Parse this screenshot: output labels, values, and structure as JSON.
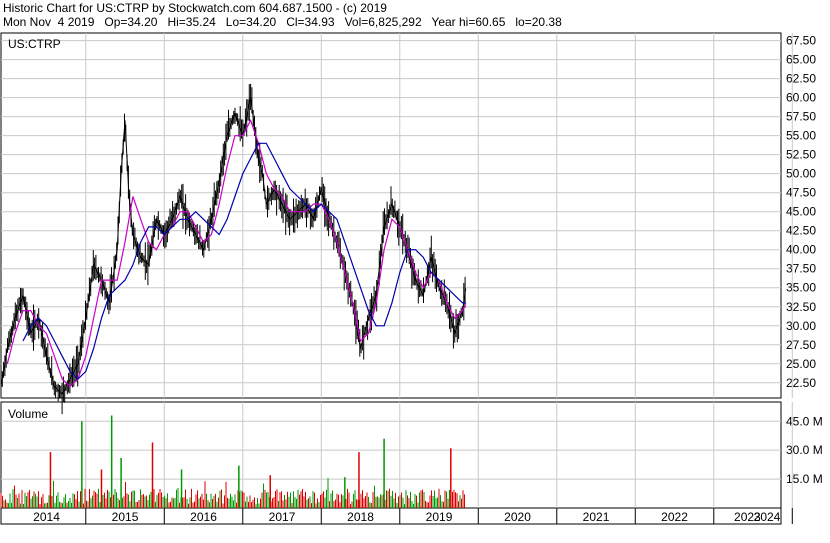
{
  "header": {
    "line1": "Historic Chart for US:CTRP by Stockwatch.com 604.687.1500 - (c) 2019",
    "line2": "Mon Nov  4 2019   Op=34.20   Hi=35.24   Lo=34.20   Cl=34.93   Vol=6,825,292   Year hi=60.65   lo=20.38"
  },
  "chart_data": [
    {
      "type": "line",
      "title": "US:CTRP",
      "x_labels": [
        "2014",
        "2015",
        "2016",
        "2017",
        "2018",
        "2019",
        "2020",
        "2021",
        "2022",
        "2023",
        "2024"
      ],
      "y_ticks": [
        "67.50",
        "65.00",
        "62.50",
        "60.00",
        "57.50",
        "55.00",
        "52.50",
        "50.00",
        "47.50",
        "45.00",
        "42.50",
        "40.00",
        "37.50",
        "35.00",
        "32.50",
        "30.00",
        "27.50",
        "25.00",
        "22.50"
      ],
      "ylim": [
        20.5,
        68.5
      ],
      "grid": true,
      "series": [
        {
          "color": "#000000",
          "x": [
            2013.92,
            2014.0,
            2014.1,
            2014.2,
            2014.3,
            2014.4,
            2014.5,
            2014.6,
            2014.7,
            2014.8,
            2014.9,
            2015.0,
            2015.1,
            2015.2,
            2015.3,
            2015.4,
            2015.45,
            2015.5,
            2015.55,
            2015.6,
            2015.7,
            2015.8,
            2015.9,
            2016.0,
            2016.1,
            2016.2,
            2016.3,
            2016.4,
            2016.5,
            2016.6,
            2016.7,
            2016.8,
            2016.9,
            2017.0,
            2017.1,
            2017.15,
            2017.2,
            2017.25,
            2017.3,
            2017.4,
            2017.5,
            2017.6,
            2017.7,
            2017.8,
            2017.9,
            2018.0,
            2018.1,
            2018.2,
            2018.3,
            2018.4,
            2018.5,
            2018.6,
            2018.7,
            2018.8,
            2018.9,
            2019.0,
            2019.1,
            2019.2,
            2019.3,
            2019.4,
            2019.5,
            2019.6,
            2019.7,
            2019.8,
            2019.84
          ],
          "values": [
            22,
            27,
            31,
            34,
            29,
            31,
            26,
            22,
            21,
            23,
            25,
            31,
            38,
            36,
            33,
            40,
            50,
            57,
            47,
            42,
            39,
            38,
            44,
            42,
            44,
            47,
            44,
            42,
            40,
            44,
            49,
            55,
            58,
            55,
            60,
            56,
            52,
            50,
            46,
            48,
            46,
            44,
            45,
            46,
            44,
            48,
            44,
            41,
            37,
            33,
            27,
            31,
            34,
            43,
            46,
            43,
            40,
            36,
            34,
            39,
            35,
            33,
            29,
            32,
            34.9
          ]
        },
        {
          "color": "#cc00cc",
          "x": [
            2014.0,
            2014.1,
            2014.2,
            2014.3,
            2014.4,
            2014.5,
            2014.6,
            2014.7,
            2014.8,
            2014.9,
            2015.0,
            2015.1,
            2015.2,
            2015.3,
            2015.4,
            2015.5,
            2015.6,
            2015.7,
            2015.8,
            2015.9,
            2016.0,
            2016.1,
            2016.2,
            2016.3,
            2016.4,
            2016.5,
            2016.6,
            2016.7,
            2016.8,
            2016.9,
            2017.0,
            2017.1,
            2017.2,
            2017.3,
            2017.4,
            2017.5,
            2017.6,
            2017.7,
            2017.8,
            2017.9,
            2018.0,
            2018.1,
            2018.2,
            2018.3,
            2018.4,
            2018.5,
            2018.6,
            2018.7,
            2018.8,
            2018.9,
            2019.0,
            2019.1,
            2019.2,
            2019.3,
            2019.4,
            2019.5,
            2019.6,
            2019.7,
            2019.8,
            2019.84
          ],
          "values": [
            25,
            29,
            32,
            32,
            30,
            29,
            26,
            23,
            22,
            23,
            26,
            31,
            36,
            36,
            36,
            41,
            47,
            44,
            41,
            40,
            42,
            43,
            45,
            45,
            43,
            41,
            42,
            46,
            51,
            55,
            55,
            57,
            54,
            50,
            48,
            47,
            45,
            45,
            45,
            46,
            46,
            44,
            41,
            37,
            33,
            28,
            29,
            33,
            40,
            44,
            43,
            40,
            37,
            35,
            37,
            36,
            33,
            31,
            32,
            33
          ]
        },
        {
          "color": "#0000aa",
          "x": [
            2014.2,
            2014.3,
            2014.4,
            2014.5,
            2014.6,
            2014.7,
            2014.8,
            2014.9,
            2015.0,
            2015.1,
            2015.2,
            2015.3,
            2015.4,
            2015.5,
            2015.6,
            2015.7,
            2015.8,
            2015.9,
            2016.0,
            2016.1,
            2016.2,
            2016.3,
            2016.4,
            2016.5,
            2016.6,
            2016.7,
            2016.8,
            2016.9,
            2017.0,
            2017.1,
            2017.2,
            2017.3,
            2017.4,
            2017.5,
            2017.6,
            2017.7,
            2017.8,
            2017.9,
            2018.0,
            2018.1,
            2018.2,
            2018.3,
            2018.4,
            2018.5,
            2018.6,
            2018.7,
            2018.8,
            2018.9,
            2019.0,
            2019.1,
            2019.2,
            2019.3,
            2019.4,
            2019.5,
            2019.6,
            2019.7,
            2019.8,
            2019.84
          ],
          "values": [
            28,
            30,
            31,
            30,
            28,
            26,
            24,
            23,
            24,
            27,
            31,
            34,
            35,
            36,
            38,
            41,
            43,
            43,
            42,
            43,
            44,
            44,
            45,
            44,
            43,
            42,
            44,
            47,
            50,
            52,
            54,
            54,
            52,
            50,
            48,
            47,
            46,
            45,
            46,
            45,
            44,
            41,
            38,
            35,
            32,
            30,
            30,
            33,
            37,
            40,
            40,
            39,
            37,
            36,
            35,
            34,
            33,
            33
          ]
        }
      ]
    },
    {
      "type": "bar",
      "title": "Volume",
      "y_ticks": [
        "45.0 M",
        "30.0 M",
        "15.0 M"
      ],
      "ylim": [
        0,
        55
      ],
      "highlight_bars": [
        {
          "x": 2014.55,
          "value": 29,
          "color": "#dd0000"
        },
        {
          "x": 2014.95,
          "value": 45,
          "color": "#009900"
        },
        {
          "x": 2015.2,
          "value": 20,
          "color": "#dd0000"
        },
        {
          "x": 2015.33,
          "value": 48,
          "color": "#009900"
        },
        {
          "x": 2015.45,
          "value": 26,
          "color": "#009900"
        },
        {
          "x": 2015.85,
          "value": 34,
          "color": "#dd0000"
        },
        {
          "x": 2016.22,
          "value": 20,
          "color": "#009900"
        },
        {
          "x": 2016.95,
          "value": 22,
          "color": "#009900"
        },
        {
          "x": 2017.35,
          "value": 17,
          "color": "#dd0000"
        },
        {
          "x": 2018.3,
          "value": 16,
          "color": "#009900"
        },
        {
          "x": 2018.48,
          "value": 29,
          "color": "#dd0000"
        },
        {
          "x": 2018.8,
          "value": 36,
          "color": "#009900"
        },
        {
          "x": 2019.65,
          "value": 31,
          "color": "#dd0000"
        }
      ]
    }
  ]
}
